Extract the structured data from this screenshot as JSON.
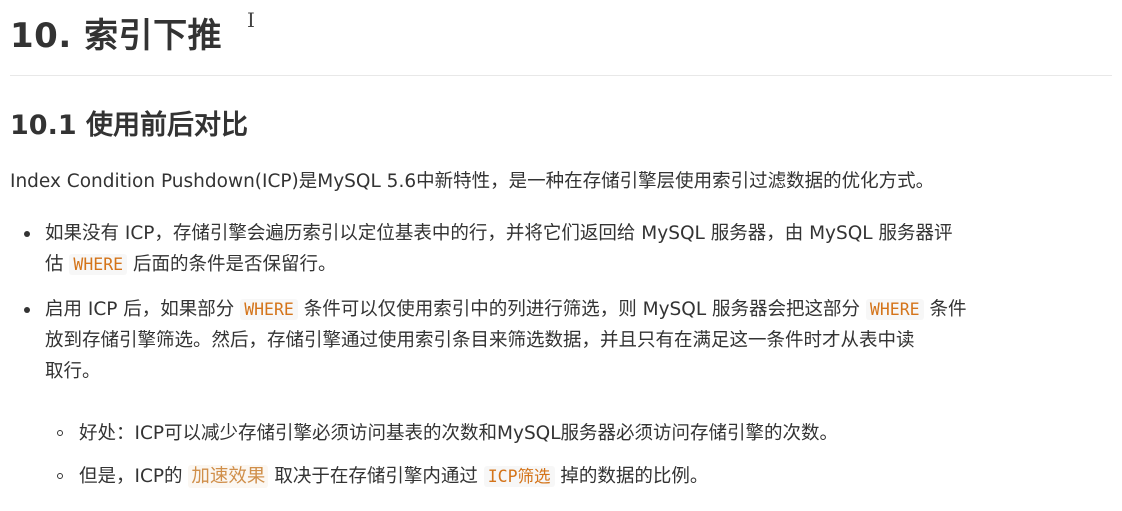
{
  "heading": {
    "title": "10. 索引下推"
  },
  "cursor_glyph": "I",
  "section": {
    "title": "10.1 使用前后对比"
  },
  "intro": "Index Condition Pushdown(ICP)是MySQL 5.6中新特性，是一种在存储引擎层使用索引过滤数据的优化方式。",
  "bullets": [
    {
      "line1": "如果没有 ICP，存储引擎会遍历索引以定位基表中的行，并将它们返回给 MySQL 服务器，由 MySQL 服务器评",
      "line2_pre": "估 ",
      "code": "WHERE",
      "line2_post": " 后面的条件是否保留行。"
    },
    {
      "pre": "启用 ICP 后，如果部分 ",
      "code1": "WHERE",
      "mid": " 条件可以仅使用索引中的列进行筛选，则 MySQL 服务器会把这部分 ",
      "code2": "WHERE",
      "post1": " 条件",
      "line2": "放到存储引擎筛选。然后，存储引擎通过使用索引条目来筛选数据，并且只有在满足这一条件时才从表中读",
      "line3": "取行。"
    }
  ],
  "subbullets": [
    {
      "text": "好处：ICP可以减少存储引擎必须访问基表的次数和MySQL服务器必须访问存储引擎的次数。"
    },
    {
      "pre": "但是，ICP的 ",
      "tint": "加速效果",
      "mid": " 取决于在存储引擎内通过 ",
      "code": "ICP筛选",
      "post": " 掉的数据的比例。"
    }
  ],
  "colors": {
    "code_text": "#d4741a",
    "text": "#333333",
    "rule": "#e8e8e8"
  }
}
